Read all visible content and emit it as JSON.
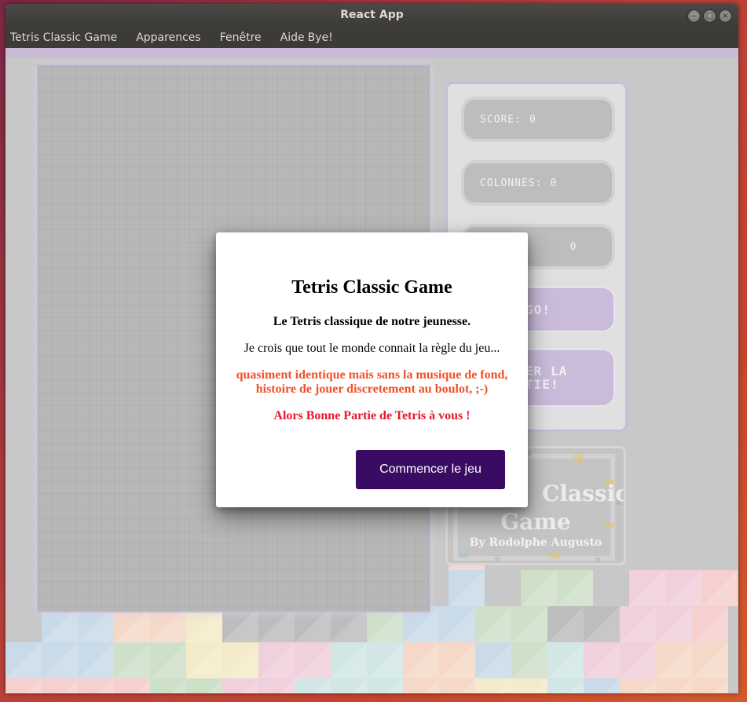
{
  "window": {
    "title": "React App"
  },
  "menu": {
    "items": [
      "Tetris Classic Game",
      "Apparences",
      "Fenêtre",
      "Aide"
    ],
    "bye": "Bye!"
  },
  "stats": {
    "score_label": "SCORE:",
    "score_value": "0",
    "columns_label": "COLONNES:",
    "columns_value": "0",
    "third_value": "0"
  },
  "actions": {
    "start_partial": "GO!",
    "restart_partial_line1": "NNER LA",
    "restart_partial_line2": "RTIE!"
  },
  "card": {
    "title_partial_line1": "Classic",
    "title_partial_line2": "Game",
    "author": "By Rodolphe Augusto"
  },
  "dialog": {
    "title": "Tetris Classic Game",
    "subtitle": "Le Tetris classique de notre jeunesse.",
    "rule": "Je crois que tout le monde connait la règle du jeu...",
    "warning": "quasiment identique mais sans la musique de fond, histoire de jouer discretement au boulot, ;-)",
    "wish": "Alors Bonne Partie de Tetris à vous !",
    "start_button": "Commencer le jeu"
  },
  "colors": {
    "accent": "#3a0b63",
    "warning": "#f0512a",
    "wish": "#e8172b",
    "panel_border": "#c8bcd8"
  }
}
